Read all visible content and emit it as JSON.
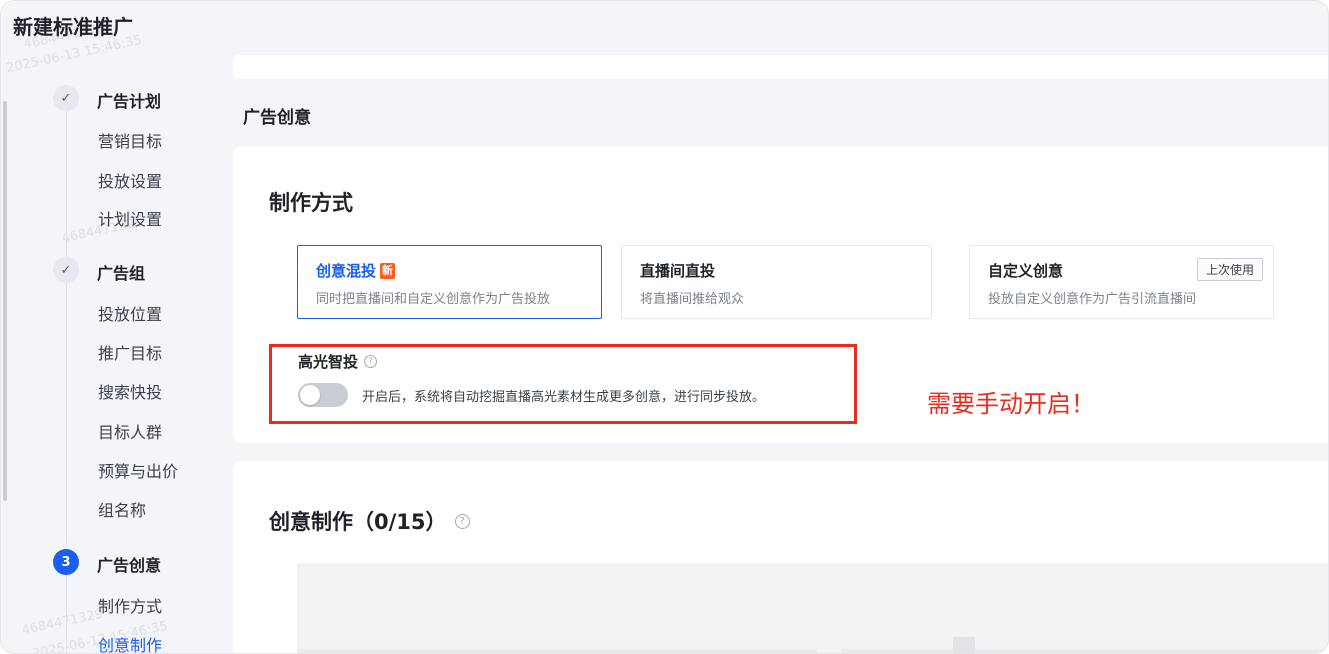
{
  "page": {
    "title": "新建标准推广"
  },
  "watermarks": [
    "4684471329",
    "2025-06-13 15:46:35"
  ],
  "sidebar": {
    "steps": [
      {
        "marker": "✓",
        "title": "广告计划",
        "items": [
          "营销目标",
          "投放设置",
          "计划设置"
        ]
      },
      {
        "marker": "✓",
        "title": "广告组",
        "items": [
          "投放位置",
          "推广目标",
          "搜索快投",
          "目标人群",
          "预算与出价",
          "组名称"
        ]
      },
      {
        "marker": "3",
        "title": "广告创意",
        "items": [
          "制作方式",
          "创意制作"
        ]
      }
    ]
  },
  "main": {
    "section_title": "广告创意",
    "method": {
      "heading": "制作方式",
      "options": [
        {
          "title": "创意混投",
          "badge": "新",
          "desc": "同时把直播间和自定义创意作为广告投放",
          "selected": true
        },
        {
          "title": "直播间直投",
          "desc": "将直播间推给观众",
          "selected": false
        },
        {
          "title": "自定义创意",
          "tag": "上次使用",
          "desc": "投放自定义创意作为广告引流直播间",
          "selected": false
        }
      ]
    },
    "highlight": {
      "title": "高光智投",
      "help": "?",
      "toggle_on": false,
      "desc": "开启后，系统将自动挖掘直播高光素材生成更多创意，进行同步投放。"
    },
    "annotation": "需要手动开启！",
    "creative": {
      "heading": "创意制作（0/15）",
      "help": "?"
    }
  },
  "colors": {
    "accent": "#1a5ff0",
    "annotation": "#ea2b1f",
    "badge": "#ff5a1f"
  }
}
